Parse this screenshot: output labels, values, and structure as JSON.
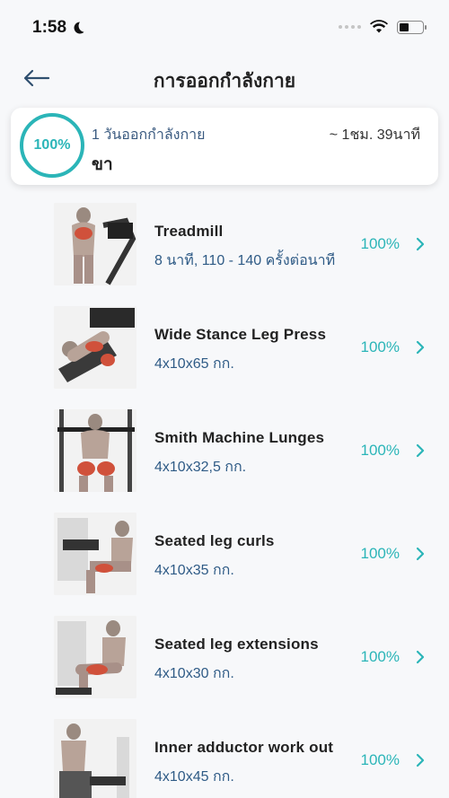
{
  "status": {
    "time": "1:58"
  },
  "header": {
    "title": "การออกกำลังกาย"
  },
  "summary": {
    "progress": "100%",
    "days_label": "1 วันออกกำลังกาย",
    "body_part": "ขา",
    "duration": "~ 1ชม. 39นาที"
  },
  "exercises": [
    {
      "name": "Treadmill",
      "detail": "8 นาที, 110 - 140 ครั้งต่อนาที",
      "progress": "100%"
    },
    {
      "name": "Wide Stance Leg Press",
      "detail": "4x10x65 กก.",
      "progress": "100%"
    },
    {
      "name": "Smith Machine Lunges",
      "detail": "4x10x32,5 กก.",
      "progress": "100%"
    },
    {
      "name": "Seated leg curls",
      "detail": "4x10x35 กก.",
      "progress": "100%"
    },
    {
      "name": "Seated leg extensions",
      "detail": "4x10x30 กก.",
      "progress": "100%"
    },
    {
      "name": "Inner adductor work out",
      "detail": "4x10x45 กก.",
      "progress": "100%"
    }
  ],
  "colors": {
    "accent": "#2bb5b8",
    "detail_text": "#2f5b86"
  }
}
